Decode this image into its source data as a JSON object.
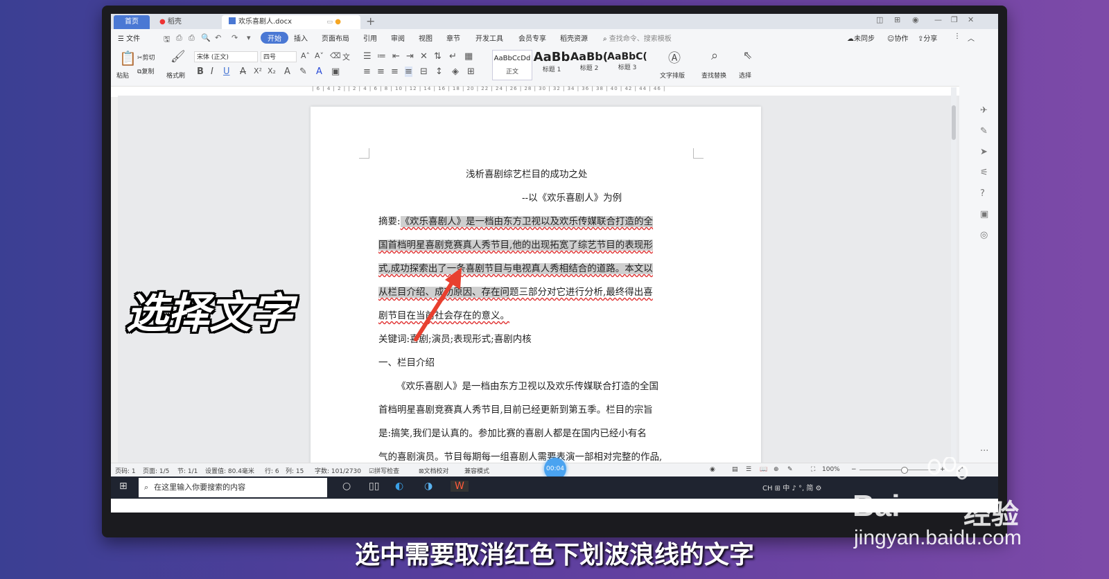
{
  "tabs": {
    "home": "首页",
    "daoke": "稻壳",
    "doc": "欢乐喜剧人.docx",
    "new_tab": "+"
  },
  "menu": {
    "file": "☰ 文件",
    "items": [
      "开始",
      "插入",
      "页面布局",
      "引用",
      "审阅",
      "视图",
      "章节",
      "开发工具",
      "会员专享",
      "稻壳资源"
    ],
    "search": "查找命令、搜索模板",
    "unsync": "未同步",
    "collab": "协作",
    "share": "分享"
  },
  "ribbon": {
    "paste": "粘贴",
    "cut": "剪切",
    "copy": "复制",
    "format_painter": "格式刷",
    "font": "宋体 (正文)",
    "size": "四号",
    "styles": [
      {
        "preview": "AaBbCcDd",
        "name": "正文"
      },
      {
        "preview": "AaBb",
        "name": "标题 1"
      },
      {
        "preview": "AaBb(",
        "name": "标题 2"
      },
      {
        "preview": "AaBbC(",
        "name": "标题 3"
      }
    ],
    "text_layout": "文字排版",
    "find_replace": "查找替换",
    "select": "选择"
  },
  "ruler": "| 6 | 4 | 2 | | 2 | 4 | 6 | 8 | 10 | 12 | 14 | 16 | 18 | 20 | 22 | 24 | 26 | 28 | 30 | 32 | 34 | 36 | 38 | 40 | 42 | 44 | 46 |",
  "document": {
    "title": "浅析喜剧综艺栏目的成功之处",
    "subtitle": "--以《欢乐喜剧人》为例",
    "abstract_label": "摘要:",
    "abstract_lines": [
      "《欢乐喜剧人》是一档由东方卫视以及欢乐传媒联合打造的全",
      "国首档明星喜剧竞赛真人秀节目,他的出现拓宽了综艺节目的表现形",
      "式,成功探索出了一条喜剧节目与电视真人秀相结合的道路。本文以",
      "从栏目介绍、成功原因、存在问",
      "题三部分对它进行分析,最终得出喜",
      "剧节目在当前社会存在的意义。"
    ],
    "keywords": "关键词:喜剧;演员;表现形式;喜剧内核",
    "section1": "一、栏目介绍",
    "body_lines": [
      "《欢乐喜剧人》是一档由东方卫视以及欢乐传媒联合打造的全国",
      "首档明星喜剧竞赛真人秀节目,目前已经更新到第五季。栏目的宗旨",
      "是:搞笑,我们是认真的。参加比赛的喜剧人都是在国内已经小有名",
      "气的喜剧演员。节目每期每一组喜剧人需要表演一部相对完整的作品,"
    ]
  },
  "status": {
    "page_num": "页码: 1",
    "pages": "页面: 1/5",
    "section": "节: 1/1",
    "setting": "设置值: 80.4毫米",
    "row": "行: 6",
    "col": "列: 15",
    "words": "字数: 101/2730",
    "spell": "拼写检查",
    "proof": "文档校对",
    "compat": "兼容模式",
    "zoom": "100%",
    "timer": "00:04"
  },
  "taskbar": {
    "search_placeholder": "在这里输入你要搜索的内容",
    "ime": "CH ⊞ 中 ♪ °, 简 ⚙"
  },
  "overlay": {
    "caption": "选择文字",
    "subtitle": "选中需要取消红色下划波浪线的文字",
    "watermark_logo": "Bai",
    "watermark_logo2": "经验",
    "watermark_url": "jingyan.baidu.com"
  },
  "colors": {
    "accent": "#4a78d4",
    "highlight": "#cfcfcf",
    "wavy": "#e03030",
    "arrow": "#e8402f"
  }
}
